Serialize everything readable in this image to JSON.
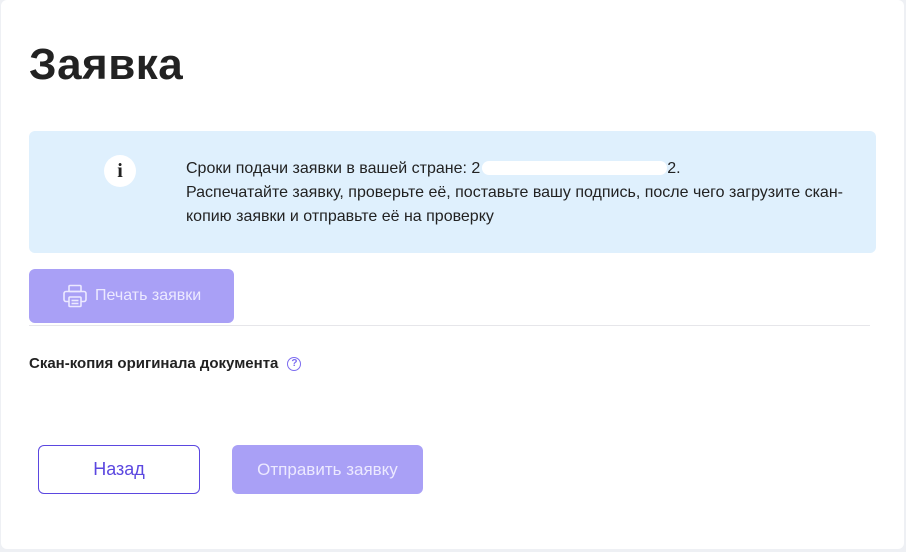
{
  "page": {
    "title": "Заявка"
  },
  "info": {
    "icon": "info-icon",
    "icon_glyph": "i",
    "deadline_prefix": "Сроки подачи заявки в вашей стране: 2",
    "deadline_suffix": "2.",
    "instructions": "Распечатайте заявку, проверьте её, поставьте вашу подпись, после чего загрузите скан-копию заявки и отправьте её на проверку"
  },
  "actions": {
    "print_label": "Печать заявки",
    "print_icon": "printer-icon"
  },
  "upload": {
    "label": "Скан-копия оригинала документа",
    "help_icon": "question-circle-icon",
    "help_glyph": "?"
  },
  "footer": {
    "back_label": "Назад",
    "submit_label": "Отправить заявку"
  },
  "colors": {
    "accent": "#5b47e0",
    "accent_disabled": "#a9a0f6",
    "info_background": "#dff0fd"
  }
}
